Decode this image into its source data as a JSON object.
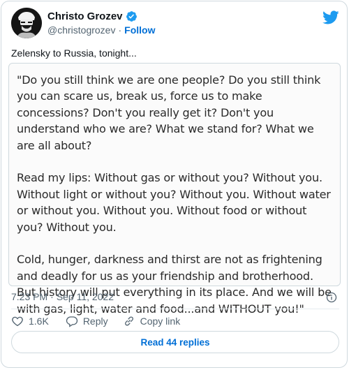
{
  "author": {
    "display_name": "Christo Grozev",
    "handle": "@christogrozev",
    "separator": "·",
    "follow_label": "Follow",
    "verified": true
  },
  "tweet": {
    "text": "Zelensky to Russia, tonight...",
    "quote_paragraphs": [
      "\"Do you still think we are one people? Do you still think you can scare us, break us, force us to make concessions? Don't you really get it? Don't you understand who we are? What we stand for? What we are all about?",
      "Read my lips: Without gas or without you? Without you. Without light or without you? Without you. Without water or without you. Without you. Without food or without you? Without you.",
      "Cold, hunger, darkness and thirst are not as frightening and deadly for us as your friendship and brotherhood. But history will put everything in its place. And we will be with gas, light, water and food...and WITHOUT you!\""
    ],
    "time": "7:23 PM",
    "date_separator": "·",
    "date": "Sep 11, 2022"
  },
  "actions": {
    "like_count": "1.6K",
    "reply_label": "Reply",
    "copy_link_label": "Copy link"
  },
  "read_replies_label": "Read 44 replies",
  "icons": {
    "brand": "twitter-bird-icon",
    "verified": "verified-badge-icon",
    "info": "info-icon",
    "like": "heart-icon",
    "reply": "reply-bubble-icon",
    "link": "link-icon"
  },
  "colors": {
    "brand": "#1d9bf0",
    "link": "#006fd6",
    "secondary_text": "#536471",
    "border": "#cfd9de"
  }
}
